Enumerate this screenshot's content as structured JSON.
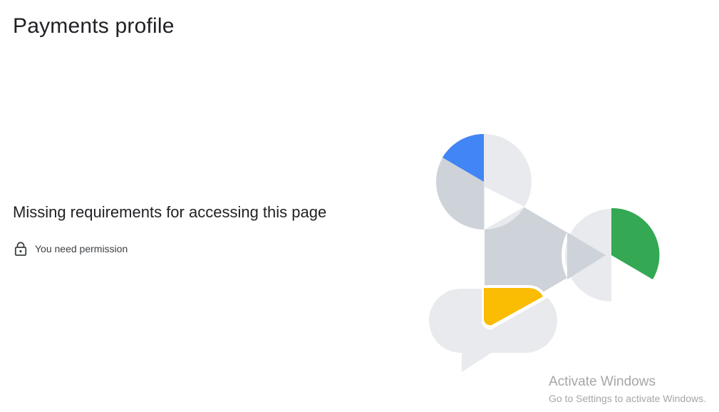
{
  "header": {
    "title": "Payments profile"
  },
  "main": {
    "heading": "Missing requirements for accessing this page",
    "permission": {
      "icon": "lock-icon",
      "text": "You need permission"
    },
    "illustration": {
      "colors": {
        "blue": "#4285F4",
        "green": "#34A853",
        "yellow": "#FBBC04",
        "light_gray": "#E8EAED",
        "mid_gray": "#CDD3D9"
      }
    }
  },
  "os_watermark": {
    "title": "Activate Windows",
    "subtitle": "Go to Settings to activate Windows."
  }
}
